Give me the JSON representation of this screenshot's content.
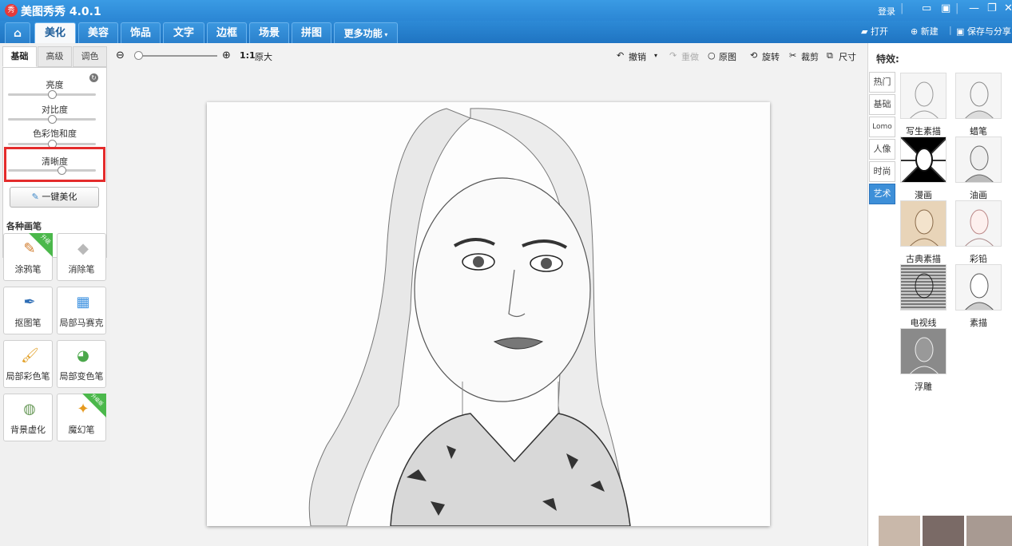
{
  "app": {
    "logo": "秀",
    "title": "美图秀秀 4.0.1",
    "login": "登录"
  },
  "nav": {
    "tabs": [
      "美化",
      "美容",
      "饰品",
      "文字",
      "边框",
      "场景",
      "拼图",
      "更多功能"
    ],
    "open": "打开",
    "new": "新建",
    "save_share": "保存与分享"
  },
  "adjust": {
    "tabs": [
      "基础",
      "高级",
      "调色"
    ],
    "brightness": "亮度",
    "brightness_level": 0.5,
    "contrast": "对比度",
    "contrast_level": 0.5,
    "saturation": "色彩饱和度",
    "saturation_level": 0.5,
    "sharpness": "清晰度",
    "sharpness_level": 0.63,
    "one_key": "一键美化"
  },
  "brushes": {
    "title": "各种画笔",
    "doodle": "涂鸦笔",
    "doodle_badge": "升级",
    "eraser": "消除笔",
    "cutout": "抠图笔",
    "mosaic": "局部马赛克",
    "local_color": "局部彩色笔",
    "local_change": "局部变色笔",
    "blur_bg": "背景虚化",
    "magic": "魔幻笔",
    "magic_badge": "升级版"
  },
  "toolbar": {
    "zoom_level": 0,
    "ratio": "1:1",
    "original_size": "原大",
    "undo": "撤销",
    "redo": "重做",
    "original": "原图",
    "rotate": "旋转",
    "crop": "裁剪",
    "size": "尺寸"
  },
  "effects": {
    "title": "特效:",
    "categories": [
      "热门",
      "基础",
      "Lomo",
      "人像",
      "时尚",
      "艺术"
    ],
    "active_category": "艺术",
    "items": [
      "写生素描",
      "蜡笔",
      "漫画",
      "油画",
      "古典素描",
      "彩铅",
      "电视线",
      "素描",
      "浮雕"
    ]
  }
}
